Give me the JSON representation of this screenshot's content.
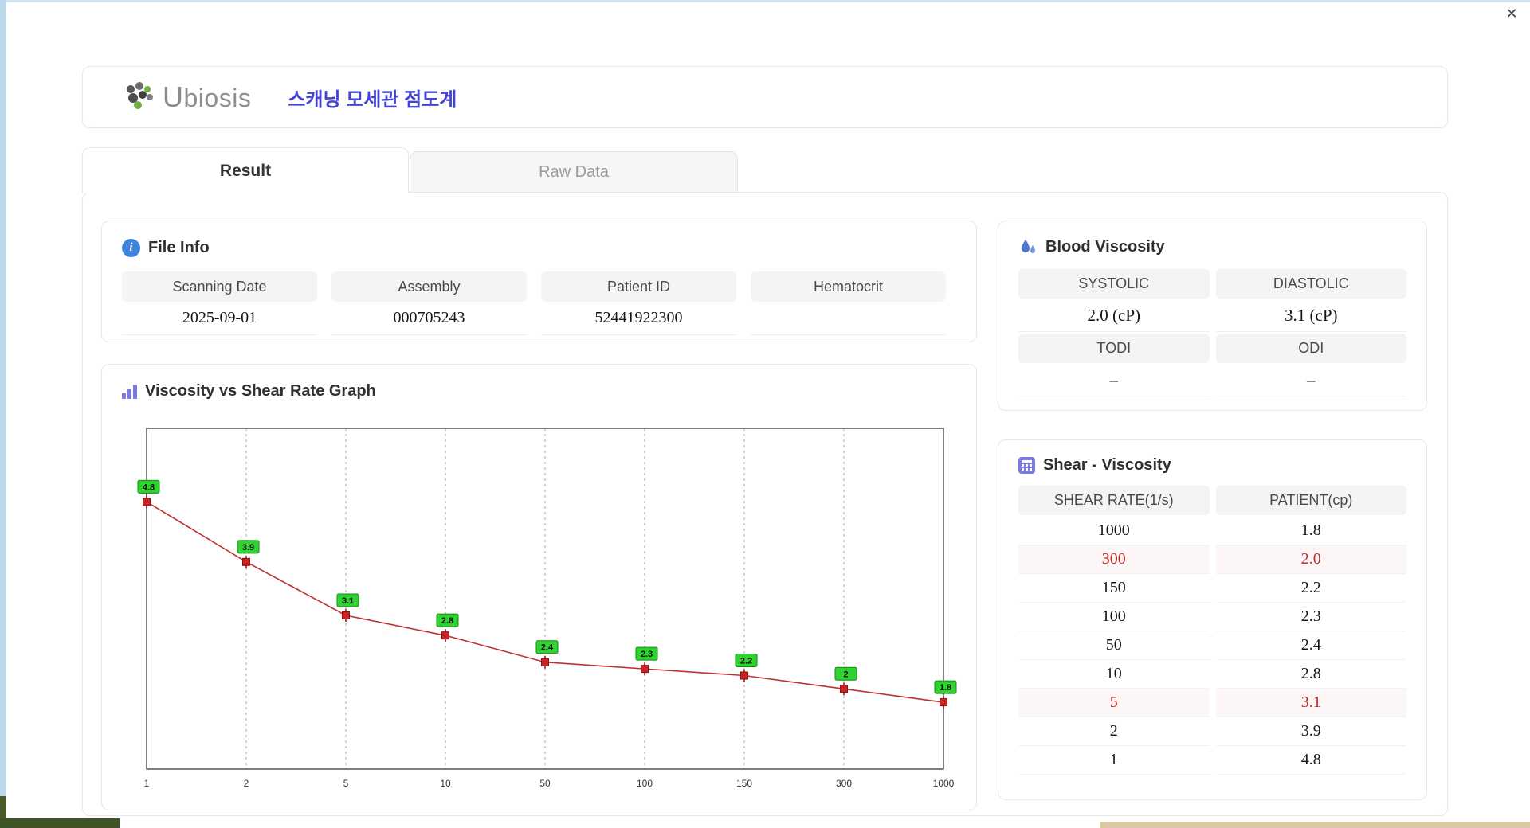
{
  "window": {
    "close_glyph": "✕"
  },
  "header": {
    "brand": "Ubiosis",
    "title": "스캐닝 모세관 점도계"
  },
  "tabs": [
    {
      "label": "Result",
      "active": true
    },
    {
      "label": "Raw Data",
      "active": false
    }
  ],
  "file_info": {
    "title": "File Info",
    "fields": [
      {
        "label": "Scanning Date",
        "value": "2025-09-01"
      },
      {
        "label": "Assembly",
        "value": "000705243"
      },
      {
        "label": "Patient ID",
        "value": "52441922300"
      },
      {
        "label": "Hematocrit",
        "value": ""
      }
    ]
  },
  "blood_viscosity": {
    "title": "Blood Viscosity",
    "cells": [
      {
        "label": "SYSTOLIC",
        "value": "2.0 (cP)"
      },
      {
        "label": "DIASTOLIC",
        "value": "3.1 (cP)"
      },
      {
        "label": "TODI",
        "value": "–"
      },
      {
        "label": "ODI",
        "value": "–"
      }
    ]
  },
  "shear_viscosity": {
    "title": "Shear - Viscosity",
    "columns": [
      "SHEAR RATE(1/s)",
      "PATIENT(cp)"
    ],
    "rows": [
      {
        "rate": "1000",
        "patient": "1.8",
        "highlight": false
      },
      {
        "rate": "300",
        "patient": "2.0",
        "highlight": true
      },
      {
        "rate": "150",
        "patient": "2.2",
        "highlight": false
      },
      {
        "rate": "100",
        "patient": "2.3",
        "highlight": false
      },
      {
        "rate": "50",
        "patient": "2.4",
        "highlight": false
      },
      {
        "rate": "10",
        "patient": "2.8",
        "highlight": false
      },
      {
        "rate": "5",
        "patient": "3.1",
        "highlight": true
      },
      {
        "rate": "2",
        "patient": "3.9",
        "highlight": false
      },
      {
        "rate": "1",
        "patient": "4.8",
        "highlight": false
      }
    ]
  },
  "chart_data": {
    "type": "line",
    "title": "Viscosity vs Shear Rate Graph",
    "x": [
      "1",
      "2",
      "5",
      "10",
      "50",
      "100",
      "150",
      "300",
      "1000"
    ],
    "values": [
      4.8,
      3.9,
      3.1,
      2.8,
      2.4,
      2.3,
      2.2,
      2.0,
      1.8
    ],
    "labels": [
      "4.8",
      "3.9",
      "3.1",
      "2.8",
      "2.4",
      "2.3",
      "2.2",
      "2",
      "1.8"
    ],
    "xlabel": "",
    "ylabel": "",
    "ylim": [
      0.8,
      5.9
    ],
    "grid": "vertical-dashed",
    "line_color": "#c03030",
    "marker_color": "#cc2222",
    "label_bg": "#2fd32f",
    "label_border": "#1a8a1a"
  },
  "colors": {
    "accent": "#4343d6",
    "red": "#c22727",
    "icon_blue": "#3d84e0",
    "icon_purple": "#7a7ae0"
  }
}
